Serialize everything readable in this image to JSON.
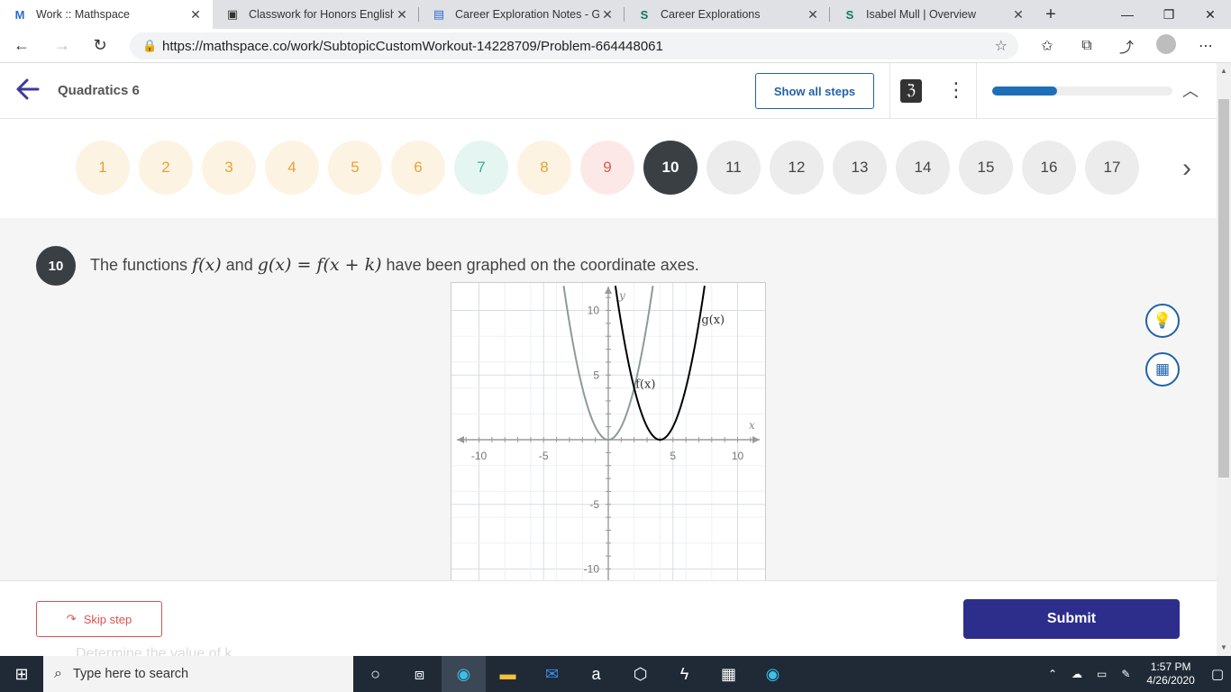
{
  "browser": {
    "tabs": [
      {
        "title": "Work :: Mathspace",
        "icon": "mathspace-icon",
        "active": true
      },
      {
        "title": "Classwork for Honors English S",
        "icon": "classroom-icon",
        "active": false
      },
      {
        "title": "Career Exploration Notes - Go",
        "icon": "docs-icon",
        "active": false
      },
      {
        "title": "Career Explorations",
        "icon": "schoology-icon",
        "active": false
      },
      {
        "title": "Isabel Mull | Overview",
        "icon": "schoology-icon",
        "active": false
      }
    ],
    "url": "https://mathspace.co/work/SubtopicCustomWorkout-14228709/Problem-664448061"
  },
  "header": {
    "title": "Quadratics 6",
    "show_steps_label": "Show all steps",
    "progress": 0.36
  },
  "problems": {
    "items": [
      {
        "n": "1",
        "state": "done"
      },
      {
        "n": "2",
        "state": "done"
      },
      {
        "n": "3",
        "state": "done"
      },
      {
        "n": "4",
        "state": "done"
      },
      {
        "n": "5",
        "state": "done"
      },
      {
        "n": "6",
        "state": "done"
      },
      {
        "n": "7",
        "state": "correct"
      },
      {
        "n": "8",
        "state": "done"
      },
      {
        "n": "9",
        "state": "wrong"
      },
      {
        "n": "10",
        "state": "current"
      },
      {
        "n": "11",
        "state": "todo"
      },
      {
        "n": "12",
        "state": "todo"
      },
      {
        "n": "13",
        "state": "todo"
      },
      {
        "n": "14",
        "state": "todo"
      },
      {
        "n": "15",
        "state": "todo"
      },
      {
        "n": "16",
        "state": "todo"
      },
      {
        "n": "17",
        "state": "todo"
      }
    ]
  },
  "question": {
    "number": "10",
    "text_1": "The functions",
    "math_f": "f(x)",
    "text_2": "and",
    "math_g": "g(x) = f(x + k)",
    "text_3": "have been graphed on the coordinate axes."
  },
  "chart_data": {
    "type": "line",
    "xlim": [
      -12,
      12
    ],
    "ylim": [
      -11,
      12
    ],
    "xlabel": "x",
    "ylabel": "y",
    "x_ticks": [
      -10,
      -5,
      5,
      10
    ],
    "y_ticks": [
      10,
      5,
      -5,
      -10
    ],
    "grid": true,
    "series": [
      {
        "name": "f(x)",
        "color": "#8e9a9a",
        "vertex": [
          0,
          0
        ],
        "a": 1
      },
      {
        "name": "g(x)",
        "color": "#000000",
        "vertex": [
          4,
          0
        ],
        "a": 1
      }
    ],
    "labels": [
      {
        "text": "f(x)",
        "x": 2.1,
        "y": 4.0
      },
      {
        "text": "g(x)",
        "x": 7.2,
        "y": 9.0
      }
    ]
  },
  "footer": {
    "skip_label": "Skip step",
    "submit_label": "Submit",
    "next_step_text": "Determine the value of k"
  },
  "taskbar": {
    "search_placeholder": "Type here to search",
    "time": "1:57 PM",
    "date": "4/26/2020"
  },
  "colors": {
    "accent": "#2d2d8c",
    "link": "#1f63a8",
    "skip": "#d9534f"
  }
}
